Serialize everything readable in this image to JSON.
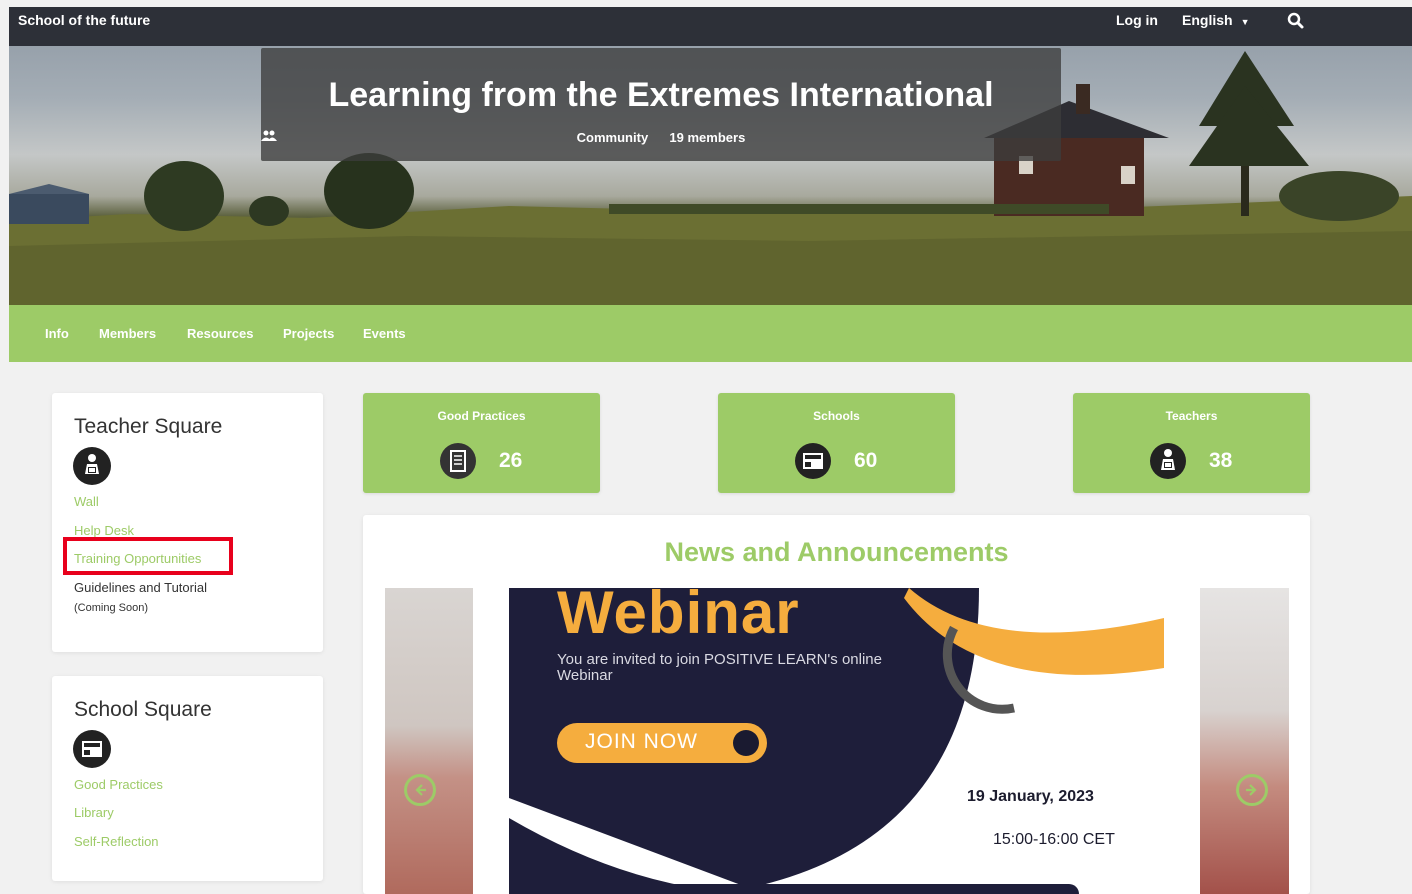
{
  "topbar": {
    "brand": "School of the future",
    "login": "Log in",
    "language": "English",
    "search_icon": "search-icon"
  },
  "hero": {
    "title": "Learning from the Extremes International",
    "type": "Community",
    "members": "19 members",
    "members_icon": "users-icon"
  },
  "nav": {
    "items": [
      "Info",
      "Members",
      "Resources",
      "Projects",
      "Events"
    ]
  },
  "teacher_square": {
    "title": "Teacher Square",
    "icon": "teacher-icon",
    "links": [
      "Wall",
      "Help Desk",
      "Training Opportunities"
    ],
    "guidelines": "Guidelines and Tutorial",
    "coming_soon": "(Coming Soon)"
  },
  "school_square": {
    "title": "School Square",
    "icon": "school-icon",
    "links": [
      "Good Practices",
      "Library",
      "Self-Reflection"
    ]
  },
  "stats": [
    {
      "label": "Good Practices",
      "value": "26",
      "icon": "document-icon"
    },
    {
      "label": "Schools",
      "value": "60",
      "icon": "school-icon"
    },
    {
      "label": "Teachers",
      "value": "38",
      "icon": "teacher-icon"
    }
  ],
  "news": {
    "title": "News and Announcements",
    "slide": {
      "headline": "Webinar",
      "subtitle": "You are invited to join POSITIVE LEARN's online Webinar",
      "button": "JOIN NOW",
      "date": "19 January, 2023",
      "time": "15:00-16:00 CET"
    },
    "prev_icon": "arrow-left-icon",
    "next_icon": "arrow-right-icon"
  },
  "colors": {
    "accent": "#9dcb67",
    "topbar": "#2d3038",
    "highlight": "#e8001c",
    "webinar_dark": "#1e1e3a",
    "webinar_orange": "#f5ad3e"
  }
}
